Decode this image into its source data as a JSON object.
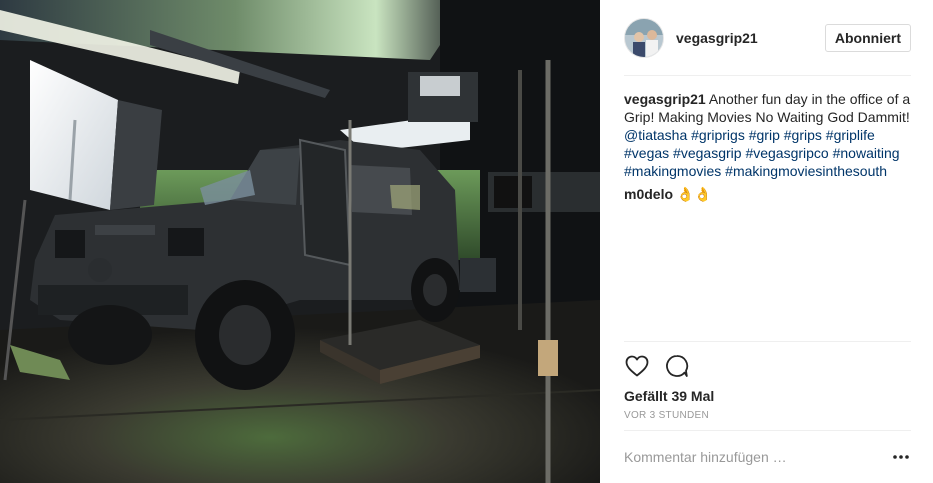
{
  "post": {
    "image_alt": "Armored vehicle on a film studio set with lights and grip stands",
    "username": "vegasgrip21",
    "follow_label": "Abonniert",
    "caption": {
      "username": "vegasgrip21",
      "text": " Another fun day in the office of a Grip! Making Movies No Waiting God Dammit! ",
      "mention": "@tiatasha",
      "tags": [
        "#griprigs",
        "#grip",
        "#grips",
        "#griplife",
        "#vegas",
        "#vegasgrip",
        "#vegasgripco",
        "#nowaiting",
        "#makingmovies",
        "#makingmoviesinthesouth"
      ]
    },
    "comment": {
      "username": "m0delo",
      "text": " 👌👌"
    },
    "likes_label": "Gefällt 39 Mal",
    "time_label": "VOR 3 STUNDEN",
    "comment_placeholder": "Kommentar hinzufügen …",
    "icons": {
      "like": "heart-icon",
      "comment": "comment-icon",
      "more": "more-options-icon"
    }
  }
}
